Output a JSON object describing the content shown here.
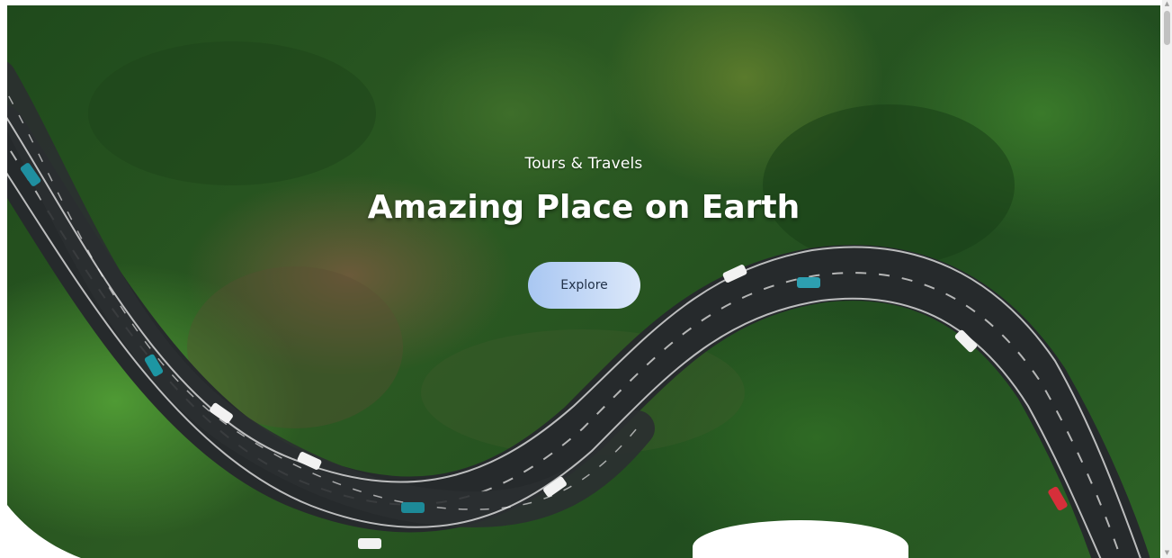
{
  "hero": {
    "subtitle": "Tours & Travels",
    "title": "Amazing Place on Earth",
    "explore_label": "Explore"
  },
  "icons": {
    "scroll_up": "scroll-up-arrow-icon",
    "scroll_down": "scroll-down-arrow-icon"
  },
  "colors": {
    "button_start": "#a9c7f2",
    "button_end": "#dce8fa",
    "title_text": "#ffffff"
  }
}
